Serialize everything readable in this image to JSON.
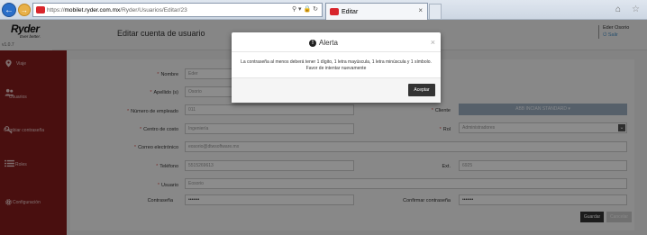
{
  "browser": {
    "url_scheme": "https://",
    "url_host": "mobilet.ryder.com.mx",
    "url_path": "/Ryder/Usuarios/Editar/23",
    "tab_title": "Editar"
  },
  "header": {
    "logo": "Ryder",
    "logo_tag": "Ever better.",
    "version": "v1.0.7",
    "page_title": "Editar cuenta de usuario",
    "user_name": "Eder Osorio",
    "exit_label": "Salir"
  },
  "sidebar": {
    "items": [
      {
        "label": "Viaje",
        "icon": "map-pin-icon"
      },
      {
        "label": "Usuarios",
        "icon": "users-icon"
      },
      {
        "label": "Cambiar contraseña",
        "icon": "key-icon"
      },
      {
        "label": "Roles",
        "icon": "list-icon"
      },
      {
        "label": "Configuración",
        "icon": "gear-icon"
      }
    ]
  },
  "form": {
    "nombre_label": "Nombre",
    "nombre_value": "Eder",
    "apellido_label": "Apellido (s)",
    "apellido_value": "Osorio",
    "empleado_label": "Número de empleado",
    "empleado_value": "011",
    "centro_label": "Centro de costo",
    "centro_value": "Ingeniería",
    "correo_label": "Correo electrónico",
    "correo_value": "eosorio@dtwsoftware.mx",
    "telefono_label": "Teléfono",
    "telefono_value": "5515269613",
    "usuario_label": "Usuario",
    "usuario_value": "Eosorio",
    "contrasena_label": "Contraseña",
    "contrasena_value": "•••••••",
    "cliente_label": "Cliente",
    "cliente_value": "ABB INCIAN STANDARD ▾",
    "rol_label": "Rol",
    "rol_value": "Administradores",
    "ext_label": "Ext.",
    "ext_value": "6925",
    "confirmar_label": "Confirmar contraseña",
    "confirmar_value": "•••••••",
    "save_label": "Guardar",
    "cancel_label": "Cancelar"
  },
  "modal": {
    "title": "Alerta",
    "message_line1": "La contraseña al menos deberá tener 1 dígito, 1 letra mayúscula, 1 letra minúscula y 1 símbolo.",
    "message_line2": "Favor de intentar nuevamente",
    "accept_label": "Aceptar"
  }
}
